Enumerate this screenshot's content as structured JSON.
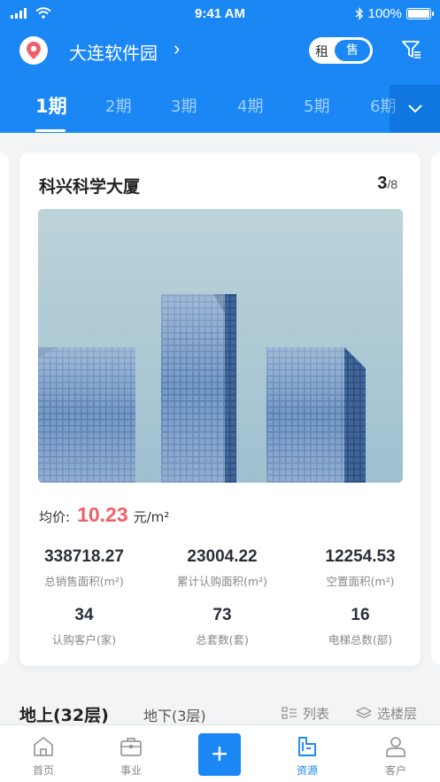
{
  "status_bar": {
    "time": "9:41 AM",
    "battery": "100%"
  },
  "location": {
    "title": "大连软件园",
    "chevron": "›"
  },
  "rent_sale": {
    "rent": "租",
    "sale": "售"
  },
  "tabs": [
    {
      "label": "1期",
      "active": true
    },
    {
      "label": "2期"
    },
    {
      "label": "3期"
    },
    {
      "label": "4期"
    },
    {
      "label": "5期"
    },
    {
      "label": "6期"
    }
  ],
  "card": {
    "title": "科兴科学大厦",
    "page_current": "3",
    "page_total": "/8",
    "avg_label": "均价:",
    "avg_value": "10.23",
    "avg_unit": "元/m²",
    "stats": [
      {
        "value": "338718.27",
        "label": "总销售面积(m²)"
      },
      {
        "value": "23004.22",
        "label": "累计认购面积(m²)"
      },
      {
        "value": "12254.53",
        "label": "空置面积(m²)"
      },
      {
        "value": "34",
        "label": "认购客户(家)"
      },
      {
        "value": "73",
        "label": "总套数(套)"
      },
      {
        "value": "16",
        "label": "电梯总数(部)"
      }
    ]
  },
  "floors": {
    "above": "地上(32层)",
    "below": "地下(3层)",
    "list": "列表",
    "choose": "选楼层"
  },
  "tabbar": {
    "home": "首页",
    "business": "事业",
    "plus": "+",
    "resources": "资源",
    "customers": "客户"
  },
  "colors": {
    "brand": "#1a87f5",
    "price": "#f0606a"
  }
}
